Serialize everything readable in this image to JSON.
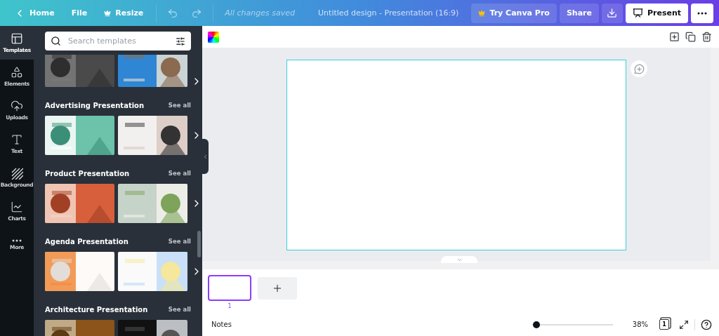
{
  "topbar": {
    "home": "Home",
    "file": "File",
    "resize": "Resize",
    "status": "All changes saved",
    "title": "Untitled design - Presentation (16:9)",
    "pro": "Try Canva Pro",
    "share": "Share",
    "present": "Present"
  },
  "rail": [
    {
      "kind": "templates",
      "label": "Templates",
      "selected": true
    },
    {
      "kind": "elements",
      "label": "Elements",
      "selected": false
    },
    {
      "kind": "uploads",
      "label": "Uploads",
      "selected": false
    },
    {
      "kind": "text",
      "label": "Text",
      "selected": false
    },
    {
      "kind": "background",
      "label": "Background",
      "selected": false
    },
    {
      "kind": "charts",
      "label": "Charts",
      "selected": false
    },
    {
      "kind": "more",
      "label": "More",
      "selected": false
    }
  ],
  "search": {
    "placeholder": "Search templates"
  },
  "sections": [
    {
      "title": "Advertising Presentation",
      "see_all": "See all"
    },
    {
      "title": "Product Presentation",
      "see_all": "See all"
    },
    {
      "title": "Agenda Presentation",
      "see_all": "See all"
    },
    {
      "title": "Architecture Presentation",
      "see_all": "See all"
    }
  ],
  "pages": [
    {
      "number": "1",
      "selected": true
    }
  ],
  "footer": {
    "notes": "Notes",
    "zoom": {
      "level": 0.05,
      "reading": "38%"
    },
    "page_count": "1"
  }
}
